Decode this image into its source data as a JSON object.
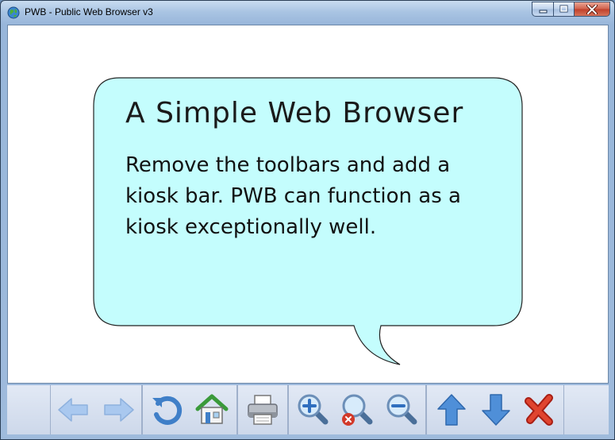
{
  "window": {
    "title": "PWB - Public Web Browser v3",
    "app_icon": "globe-icon",
    "controls": [
      "minimize-icon",
      "maximize-icon",
      "close-icon"
    ]
  },
  "content": {
    "bubble": {
      "title": "A Simple Web Browser",
      "body": "Remove the toolbars and add a kiosk bar. PWB can function as a kiosk exceptionally well.",
      "fill_color": "#c4fdfd",
      "border_color": "#222222"
    }
  },
  "kiosk_bar": {
    "buttons": [
      {
        "name": "back",
        "icon": "arrow-left-icon"
      },
      {
        "name": "forward",
        "icon": "arrow-right-icon"
      },
      {
        "name": "refresh",
        "icon": "refresh-icon"
      },
      {
        "name": "home",
        "icon": "home-icon"
      },
      {
        "name": "print",
        "icon": "printer-icon"
      },
      {
        "name": "zoom-in",
        "icon": "zoom-in-icon"
      },
      {
        "name": "zoom-reset",
        "icon": "zoom-reset-icon"
      },
      {
        "name": "zoom-out",
        "icon": "zoom-out-icon"
      },
      {
        "name": "scroll-up",
        "icon": "arrow-up-icon"
      },
      {
        "name": "scroll-down",
        "icon": "arrow-down-icon"
      },
      {
        "name": "close",
        "icon": "close-x-icon"
      }
    ]
  }
}
